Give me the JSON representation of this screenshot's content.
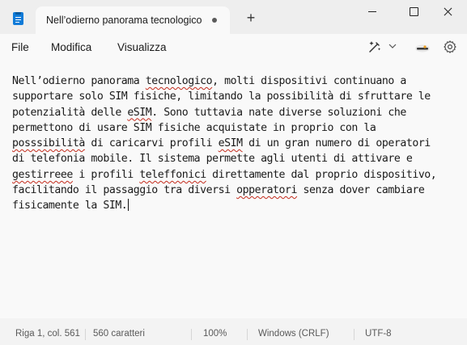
{
  "window": {
    "tab_title": "Nell’odierno panorama tecnologico"
  },
  "menu": {
    "file": "File",
    "edit": "Modifica",
    "view": "Visualizza"
  },
  "toolbar_icons": [
    "copilot-icon",
    "chevron-down-icon",
    "account-icon",
    "gear-icon"
  ],
  "document": {
    "lines": [
      [
        {
          "t": "Nell’odierno panorama "
        },
        {
          "t": "tecnologico",
          "sp": true
        },
        {
          "t": ", molti dispositivi continuano a"
        }
      ],
      [
        {
          "t": "supportare solo SIM fisiche, limitando la possibilità di sfruttare le"
        }
      ],
      [
        {
          "t": "potenzialità delle "
        },
        {
          "t": "eSIM",
          "sp": true
        },
        {
          "t": ". Sono tuttavia nate diverse soluzioni che"
        }
      ],
      [
        {
          "t": "permettono di usare SIM fisiche acquistate in proprio con la"
        }
      ],
      [
        {
          "t": "posssibilità",
          "sp": true
        },
        {
          "t": " di caricarvi profili "
        },
        {
          "t": "eSIM",
          "sp": true
        },
        {
          "t": " di un gran numero di operatori"
        }
      ],
      [
        {
          "t": "di telefonia mobile. Il sistema permette agli utenti di attivare e"
        }
      ],
      [
        {
          "t": "gestirreee",
          "sp": true
        },
        {
          "t": " i profili "
        },
        {
          "t": "teleffonici",
          "sp": true
        },
        {
          "t": " direttamente dal proprio dispositivo,"
        }
      ],
      [
        {
          "t": "facilitando il passaggio tra diversi "
        },
        {
          "t": "opperatori",
          "sp": true
        },
        {
          "t": " senza dover cambiare"
        }
      ],
      [
        {
          "t": "fisicamente la SIM."
        }
      ]
    ]
  },
  "status": {
    "position": "Riga 1, col. 561",
    "chars": "560 caratteri",
    "zoom": "100%",
    "eol": "Windows (CRLF)",
    "encoding": "UTF-8"
  },
  "colors": {
    "accent": "#0f7bd8",
    "spellcheck": "#c42b1c"
  }
}
